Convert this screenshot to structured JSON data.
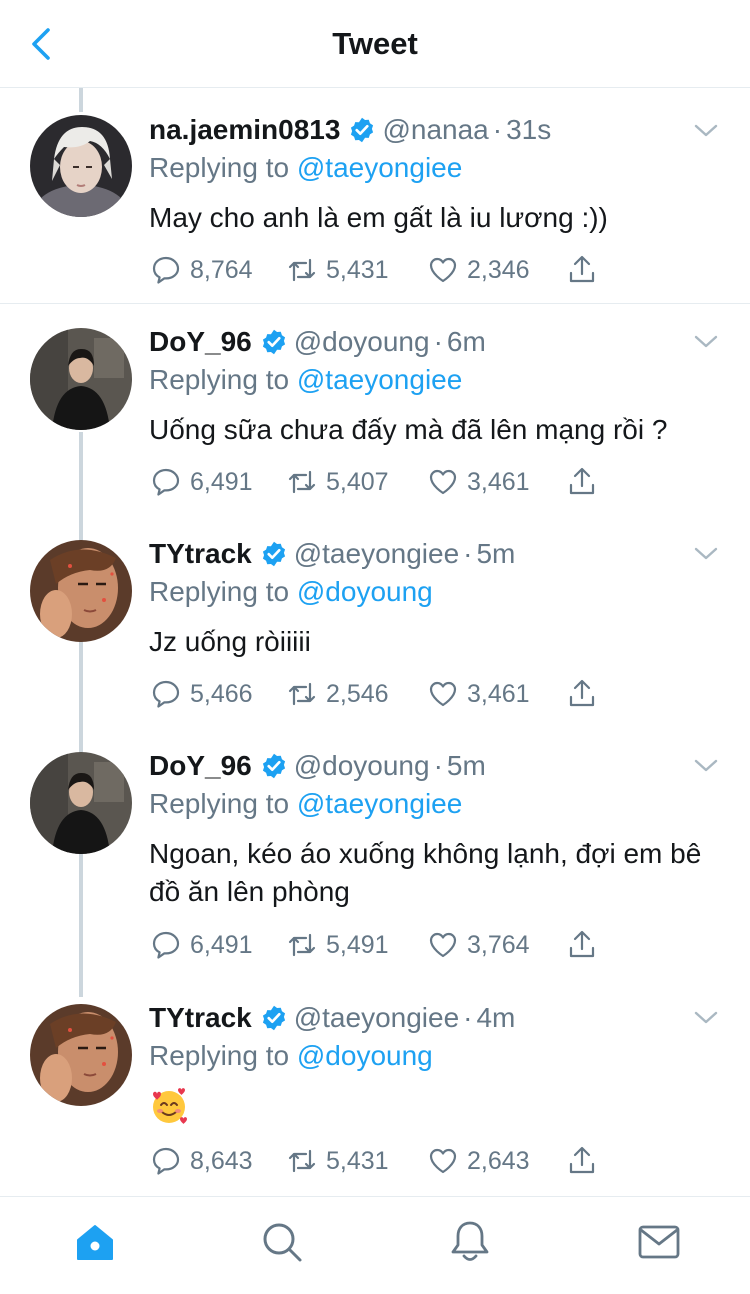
{
  "header": {
    "title": "Tweet",
    "back_icon": "chevron-left-icon"
  },
  "colors": {
    "accent": "#1da1f2",
    "muted": "#657786",
    "text": "#14171a",
    "divider": "#e6ecf0"
  },
  "tweets": [
    {
      "display_name": "na.jaemin0813",
      "handle": "@nanaa",
      "time": "31s",
      "replying_prefix": "Replying to",
      "replying_to": "@taeyongiee",
      "text": "May cho anh là em gất là iu lương :))",
      "replies": "8,764",
      "retweets": "5,431",
      "likes": "2,346"
    },
    {
      "display_name": "DoY_96",
      "handle": "@doyoung",
      "time": "6m",
      "replying_prefix": "Replying to",
      "replying_to": "@taeyongiee",
      "text": "Uống sữa chưa đấy mà đã lên mạng rồi ?",
      "replies": "6,491",
      "retweets": "5,407",
      "likes": "3,461"
    },
    {
      "display_name": "TYtrack",
      "handle": "@taeyongiee",
      "time": "5m",
      "replying_prefix": "Replying to",
      "replying_to": "@doyoung",
      "text": "Jz uống ròiiiii",
      "replies": "5,466",
      "retweets": "2,546",
      "likes": "3,461"
    },
    {
      "display_name": "DoY_96",
      "handle": "@doyoung",
      "time": "5m",
      "replying_prefix": "Replying to",
      "replying_to": "@taeyongiee",
      "text": "Ngoan, kéo áo xuống không lạnh, đợi em bê đồ ăn lên phòng",
      "replies": "6,491",
      "retweets": "5,491",
      "likes": "3,764"
    },
    {
      "display_name": "TYtrack",
      "handle": "@taeyongiee",
      "time": "4m",
      "replying_prefix": "Replying to",
      "replying_to": "@doyoung",
      "text": "",
      "emoji": "smiling-face-with-hearts",
      "replies": "8,643",
      "retweets": "5,431",
      "likes": "2,643"
    }
  ],
  "tabbar": {
    "icons": [
      "home-icon",
      "search-icon",
      "notifications-icon",
      "messages-icon"
    ]
  }
}
